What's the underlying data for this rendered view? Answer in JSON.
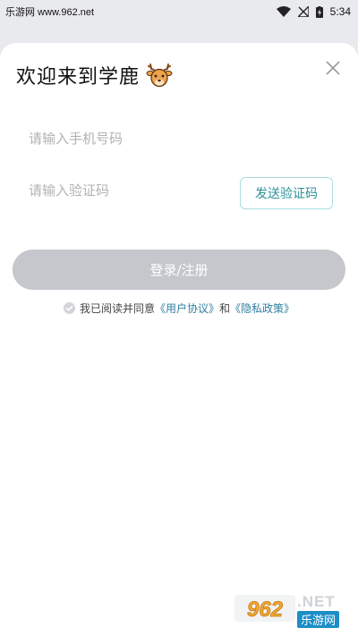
{
  "status_bar": {
    "carrier_text": "乐游网 www.962.net",
    "time": "5:34"
  },
  "login": {
    "title": "欢迎来到学鹿",
    "phone_placeholder": "请输入手机号码",
    "code_placeholder": "请输入验证码",
    "send_code_label": "发送验证码",
    "login_label": "登录/注册",
    "agreement_prefix": "我已阅读并同意",
    "user_agreement": "《用户协议》",
    "agreement_and": "和",
    "privacy_policy": "《隐私政策》"
  },
  "watermark": {
    "logo_text": "962",
    "net_text": ".NET",
    "site_text": "乐游网"
  },
  "colors": {
    "accent": "#2e8f99",
    "button_disabled": "#c5c7cc",
    "link": "#2e7fa0"
  }
}
